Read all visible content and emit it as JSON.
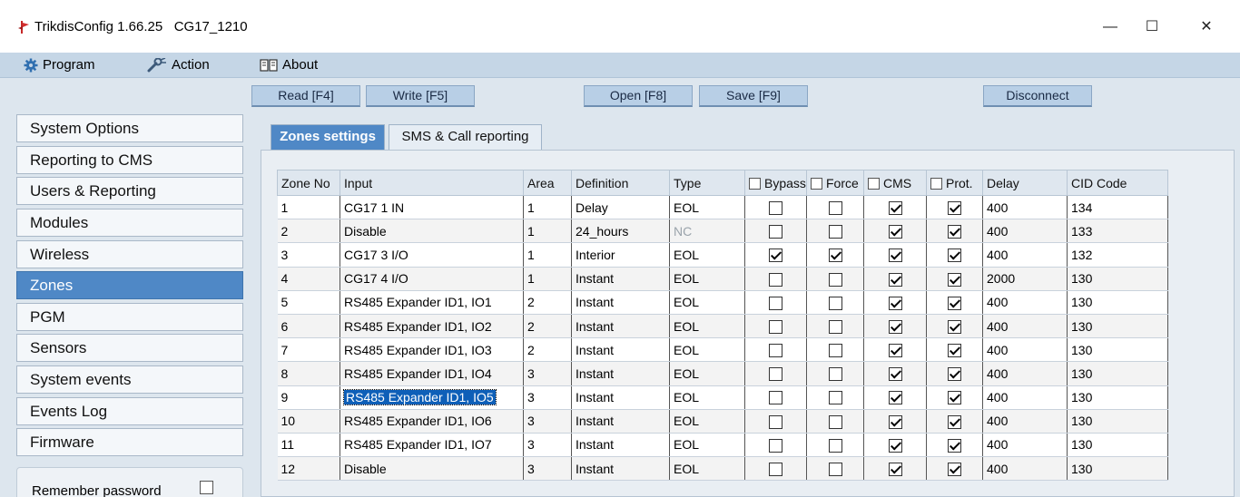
{
  "window": {
    "title": "TrikdisConfig 1.66.25",
    "device": "CG17_1210",
    "minimize": "—",
    "maximize": "☐",
    "close": "✕"
  },
  "menu": {
    "program": "Program",
    "action": "Action",
    "about": "About"
  },
  "toolbar": {
    "read": "Read [F4]",
    "write": "Write [F5]",
    "open": "Open [F8]",
    "save": "Save [F9]",
    "disconnect": "Disconnect"
  },
  "sidebar": {
    "items": [
      "System Options",
      "Reporting to CMS",
      "Users & Reporting",
      "Modules",
      "Wireless",
      "Zones",
      "PGM",
      "Sensors",
      "System events",
      "Events Log",
      "Firmware"
    ],
    "active": "Zones",
    "remember_password": "Remember password"
  },
  "tabs": {
    "zones_settings": "Zones settings",
    "sms_call": "SMS & Call reporting"
  },
  "grid": {
    "headers": {
      "zone_no": "Zone No",
      "input": "Input",
      "area": "Area",
      "definition": "Definition",
      "type": "Type",
      "bypass": "Bypass",
      "force": "Force",
      "cms": "CMS",
      "prot": "Prot.",
      "delay": "Delay",
      "cid": "CID Code"
    },
    "rows": [
      {
        "zone": "1",
        "input": "CG17 1 IN",
        "area": "1",
        "definition": "Delay",
        "type": "EOL",
        "bypass": false,
        "force": false,
        "cms": true,
        "prot": true,
        "delay": "400",
        "cid": "134"
      },
      {
        "zone": "2",
        "input": "Disable",
        "area": "1",
        "definition": "24_hours",
        "type": "NC",
        "bypass": false,
        "force": false,
        "cms": true,
        "prot": true,
        "delay": "400",
        "cid": "133"
      },
      {
        "zone": "3",
        "input": "CG17 3 I/O",
        "area": "1",
        "definition": "Interior",
        "type": "EOL",
        "bypass": true,
        "force": true,
        "cms": true,
        "prot": true,
        "delay": "400",
        "cid": "132"
      },
      {
        "zone": "4",
        "input": "CG17 4 I/O",
        "area": "1",
        "definition": "Instant",
        "type": "EOL",
        "bypass": false,
        "force": false,
        "cms": true,
        "prot": true,
        "delay": "2000",
        "cid": "130"
      },
      {
        "zone": "5",
        "input": "RS485 Expander ID1, IO1",
        "area": "2",
        "definition": "Instant",
        "type": "EOL",
        "bypass": false,
        "force": false,
        "cms": true,
        "prot": true,
        "delay": "400",
        "cid": "130"
      },
      {
        "zone": "6",
        "input": "RS485 Expander ID1, IO2",
        "area": "2",
        "definition": "Instant",
        "type": "EOL",
        "bypass": false,
        "force": false,
        "cms": true,
        "prot": true,
        "delay": "400",
        "cid": "130"
      },
      {
        "zone": "7",
        "input": "RS485 Expander ID1, IO3",
        "area": "2",
        "definition": "Instant",
        "type": "EOL",
        "bypass": false,
        "force": false,
        "cms": true,
        "prot": true,
        "delay": "400",
        "cid": "130"
      },
      {
        "zone": "8",
        "input": "RS485 Expander ID1, IO4",
        "area": "3",
        "definition": "Instant",
        "type": "EOL",
        "bypass": false,
        "force": false,
        "cms": true,
        "prot": true,
        "delay": "400",
        "cid": "130"
      },
      {
        "zone": "9",
        "input": "RS485 Expander ID1, IO5",
        "area": "3",
        "definition": "Instant",
        "type": "EOL",
        "bypass": false,
        "force": false,
        "cms": true,
        "prot": true,
        "delay": "400",
        "cid": "130",
        "selected": true
      },
      {
        "zone": "10",
        "input": "RS485 Expander ID1, IO6",
        "area": "3",
        "definition": "Instant",
        "type": "EOL",
        "bypass": false,
        "force": false,
        "cms": true,
        "prot": true,
        "delay": "400",
        "cid": "130"
      },
      {
        "zone": "11",
        "input": "RS485 Expander ID1, IO7",
        "area": "3",
        "definition": "Instant",
        "type": "EOL",
        "bypass": false,
        "force": false,
        "cms": true,
        "prot": true,
        "delay": "400",
        "cid": "130"
      },
      {
        "zone": "12",
        "input": "Disable",
        "area": "3",
        "definition": "Instant",
        "type": "EOL",
        "bypass": false,
        "force": false,
        "cms": true,
        "prot": true,
        "delay": "400",
        "cid": "130"
      }
    ]
  },
  "colors": {
    "menubar": "#c5d6e6",
    "accent": "#4f88c6",
    "selection": "#0e5fb8"
  }
}
